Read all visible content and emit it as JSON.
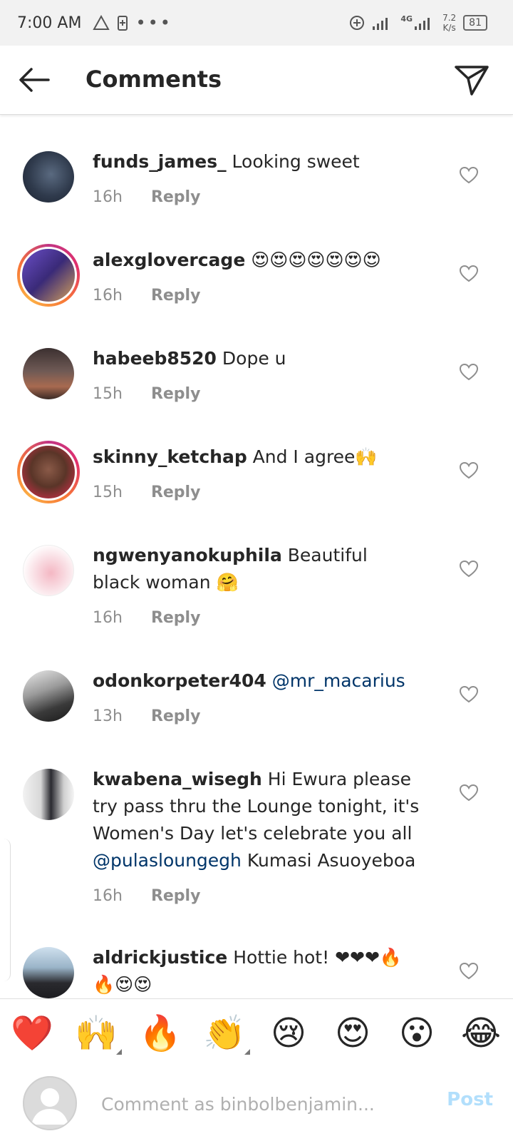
{
  "status_bar": {
    "time": "7:00 AM",
    "network": "4G",
    "speed_value": "7.2",
    "speed_unit": "K/s",
    "battery": "81"
  },
  "header": {
    "title": "Comments",
    "back_icon": "arrow-left-icon",
    "share_icon": "paper-plane-icon"
  },
  "comments": [
    {
      "username": "funds_james_",
      "text": "Looking sweet",
      "mention": "",
      "tail": "",
      "time": "16h",
      "reply": "Reply"
    },
    {
      "username": "alexglovercage",
      "text": "😍😍😍😍😍😍😍",
      "mention": "",
      "tail": "",
      "time": "16h",
      "reply": "Reply"
    },
    {
      "username": "habeeb8520",
      "text": "Dope u",
      "mention": "",
      "tail": "",
      "time": "15h",
      "reply": "Reply"
    },
    {
      "username": "skinny_ketchap",
      "text": "And I agree🙌",
      "mention": "",
      "tail": "",
      "time": "15h",
      "reply": "Reply"
    },
    {
      "username": "ngwenyanokuphila",
      "text": "Beautiful black woman 🤗",
      "mention": "",
      "tail": "",
      "time": "16h",
      "reply": "Reply"
    },
    {
      "username": "odonkorpeter404",
      "text": "",
      "mention": "@mr_macarius",
      "tail": "",
      "time": "13h",
      "reply": "Reply"
    },
    {
      "username": "kwabena_wisegh",
      "text": "Hi Ewura please try pass thru the Lounge tonight, it's Women's Day let's celebrate you all",
      "mention": "@pulasloungegh",
      "tail": "Kumasi Asuoyeboa",
      "time": "16h",
      "reply": "Reply"
    },
    {
      "username": "aldrickjustice",
      "text": "Hottie hot! ❤❤❤🔥🔥😍😍",
      "mention": "",
      "tail": "",
      "time": "",
      "reply": ""
    }
  ],
  "emoji_bar": [
    "❤️",
    "🙌",
    "🔥",
    "👏",
    "😢",
    "😍",
    "😮",
    "😂"
  ],
  "comment_box": {
    "placeholder": "Comment as binbolbenjamin...",
    "post_label": "Post"
  },
  "colors": {
    "link": "#003569",
    "meta": "#8e8e8e",
    "post_disabled": "#b2dffc",
    "heart_red": "#ed4956"
  }
}
